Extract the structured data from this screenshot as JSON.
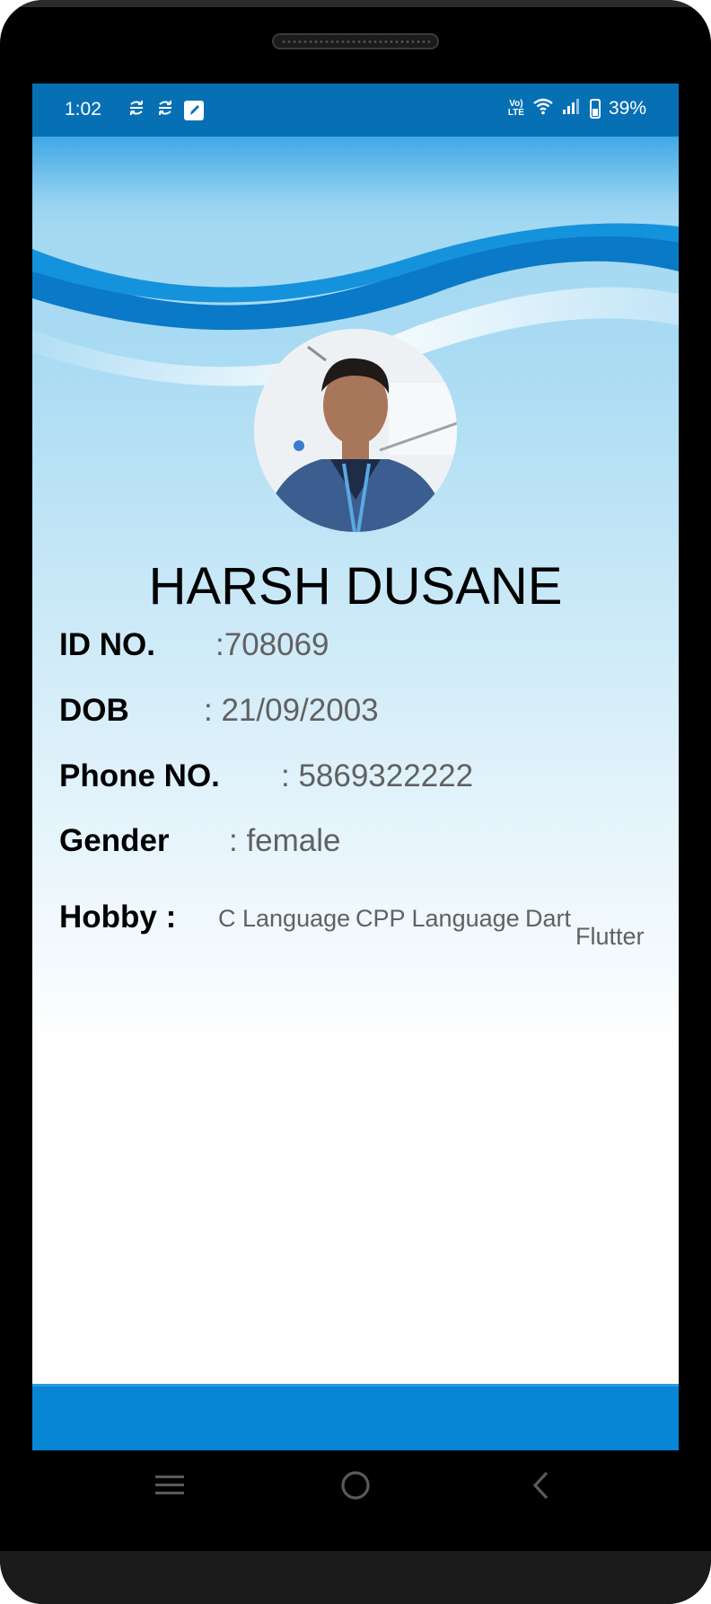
{
  "status_bar": {
    "time": "1:02",
    "left_icons": [
      "sync-icon",
      "sync-icon",
      "edit-note-icon"
    ],
    "right_icons": [
      "volte-icon",
      "wifi-icon",
      "signal-icon",
      "battery-charging-icon"
    ],
    "volte_top": "Vo)",
    "volte_bottom": "LTE",
    "battery_percent": "39%",
    "bar_color": "#0770b5"
  },
  "profile": {
    "name": "HARSH  DUSANE",
    "fields": [
      {
        "label": "ID NO.",
        "value": ":708069"
      },
      {
        "label": "DOB",
        "value": ": 21/09/2003"
      },
      {
        "label": "Phone NO.",
        "value": ": 5869322222"
      },
      {
        "label": "Gender",
        "value": ": female"
      }
    ],
    "hobby": {
      "label": "Hobby  :",
      "items": [
        "C Language",
        "CPP Language",
        "Dart",
        "Flutter"
      ]
    }
  },
  "colors": {
    "accent_blue": "#0786d6",
    "wave_dark": "#0a79c7",
    "label_text": "#000000",
    "value_text": "#616161"
  },
  "nav_bar": {
    "buttons": [
      "recent-apps-icon",
      "home-icon",
      "back-icon"
    ]
  }
}
